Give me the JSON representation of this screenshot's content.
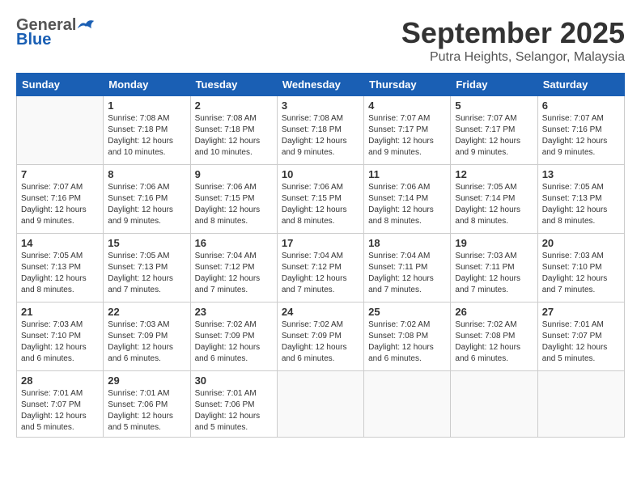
{
  "logo": {
    "general": "General",
    "blue": "Blue"
  },
  "title": "September 2025",
  "location": "Putra Heights, Selangor, Malaysia",
  "weekdays": [
    "Sunday",
    "Monday",
    "Tuesday",
    "Wednesday",
    "Thursday",
    "Friday",
    "Saturday"
  ],
  "weeks": [
    [
      {
        "day": "",
        "sunrise": "",
        "sunset": "",
        "daylight": ""
      },
      {
        "day": "1",
        "sunrise": "Sunrise: 7:08 AM",
        "sunset": "Sunset: 7:18 PM",
        "daylight": "Daylight: 12 hours and 10 minutes."
      },
      {
        "day": "2",
        "sunrise": "Sunrise: 7:08 AM",
        "sunset": "Sunset: 7:18 PM",
        "daylight": "Daylight: 12 hours and 10 minutes."
      },
      {
        "day": "3",
        "sunrise": "Sunrise: 7:08 AM",
        "sunset": "Sunset: 7:18 PM",
        "daylight": "Daylight: 12 hours and 9 minutes."
      },
      {
        "day": "4",
        "sunrise": "Sunrise: 7:07 AM",
        "sunset": "Sunset: 7:17 PM",
        "daylight": "Daylight: 12 hours and 9 minutes."
      },
      {
        "day": "5",
        "sunrise": "Sunrise: 7:07 AM",
        "sunset": "Sunset: 7:17 PM",
        "daylight": "Daylight: 12 hours and 9 minutes."
      },
      {
        "day": "6",
        "sunrise": "Sunrise: 7:07 AM",
        "sunset": "Sunset: 7:16 PM",
        "daylight": "Daylight: 12 hours and 9 minutes."
      }
    ],
    [
      {
        "day": "7",
        "sunrise": "Sunrise: 7:07 AM",
        "sunset": "Sunset: 7:16 PM",
        "daylight": "Daylight: 12 hours and 9 minutes."
      },
      {
        "day": "8",
        "sunrise": "Sunrise: 7:06 AM",
        "sunset": "Sunset: 7:16 PM",
        "daylight": "Daylight: 12 hours and 9 minutes."
      },
      {
        "day": "9",
        "sunrise": "Sunrise: 7:06 AM",
        "sunset": "Sunset: 7:15 PM",
        "daylight": "Daylight: 12 hours and 8 minutes."
      },
      {
        "day": "10",
        "sunrise": "Sunrise: 7:06 AM",
        "sunset": "Sunset: 7:15 PM",
        "daylight": "Daylight: 12 hours and 8 minutes."
      },
      {
        "day": "11",
        "sunrise": "Sunrise: 7:06 AM",
        "sunset": "Sunset: 7:14 PM",
        "daylight": "Daylight: 12 hours and 8 minutes."
      },
      {
        "day": "12",
        "sunrise": "Sunrise: 7:05 AM",
        "sunset": "Sunset: 7:14 PM",
        "daylight": "Daylight: 12 hours and 8 minutes."
      },
      {
        "day": "13",
        "sunrise": "Sunrise: 7:05 AM",
        "sunset": "Sunset: 7:13 PM",
        "daylight": "Daylight: 12 hours and 8 minutes."
      }
    ],
    [
      {
        "day": "14",
        "sunrise": "Sunrise: 7:05 AM",
        "sunset": "Sunset: 7:13 PM",
        "daylight": "Daylight: 12 hours and 8 minutes."
      },
      {
        "day": "15",
        "sunrise": "Sunrise: 7:05 AM",
        "sunset": "Sunset: 7:13 PM",
        "daylight": "Daylight: 12 hours and 7 minutes."
      },
      {
        "day": "16",
        "sunrise": "Sunrise: 7:04 AM",
        "sunset": "Sunset: 7:12 PM",
        "daylight": "Daylight: 12 hours and 7 minutes."
      },
      {
        "day": "17",
        "sunrise": "Sunrise: 7:04 AM",
        "sunset": "Sunset: 7:12 PM",
        "daylight": "Daylight: 12 hours and 7 minutes."
      },
      {
        "day": "18",
        "sunrise": "Sunrise: 7:04 AM",
        "sunset": "Sunset: 7:11 PM",
        "daylight": "Daylight: 12 hours and 7 minutes."
      },
      {
        "day": "19",
        "sunrise": "Sunrise: 7:03 AM",
        "sunset": "Sunset: 7:11 PM",
        "daylight": "Daylight: 12 hours and 7 minutes."
      },
      {
        "day": "20",
        "sunrise": "Sunrise: 7:03 AM",
        "sunset": "Sunset: 7:10 PM",
        "daylight": "Daylight: 12 hours and 7 minutes."
      }
    ],
    [
      {
        "day": "21",
        "sunrise": "Sunrise: 7:03 AM",
        "sunset": "Sunset: 7:10 PM",
        "daylight": "Daylight: 12 hours and 6 minutes."
      },
      {
        "day": "22",
        "sunrise": "Sunrise: 7:03 AM",
        "sunset": "Sunset: 7:09 PM",
        "daylight": "Daylight: 12 hours and 6 minutes."
      },
      {
        "day": "23",
        "sunrise": "Sunrise: 7:02 AM",
        "sunset": "Sunset: 7:09 PM",
        "daylight": "Daylight: 12 hours and 6 minutes."
      },
      {
        "day": "24",
        "sunrise": "Sunrise: 7:02 AM",
        "sunset": "Sunset: 7:09 PM",
        "daylight": "Daylight: 12 hours and 6 minutes."
      },
      {
        "day": "25",
        "sunrise": "Sunrise: 7:02 AM",
        "sunset": "Sunset: 7:08 PM",
        "daylight": "Daylight: 12 hours and 6 minutes."
      },
      {
        "day": "26",
        "sunrise": "Sunrise: 7:02 AM",
        "sunset": "Sunset: 7:08 PM",
        "daylight": "Daylight: 12 hours and 6 minutes."
      },
      {
        "day": "27",
        "sunrise": "Sunrise: 7:01 AM",
        "sunset": "Sunset: 7:07 PM",
        "daylight": "Daylight: 12 hours and 5 minutes."
      }
    ],
    [
      {
        "day": "28",
        "sunrise": "Sunrise: 7:01 AM",
        "sunset": "Sunset: 7:07 PM",
        "daylight": "Daylight: 12 hours and 5 minutes."
      },
      {
        "day": "29",
        "sunrise": "Sunrise: 7:01 AM",
        "sunset": "Sunset: 7:06 PM",
        "daylight": "Daylight: 12 hours and 5 minutes."
      },
      {
        "day": "30",
        "sunrise": "Sunrise: 7:01 AM",
        "sunset": "Sunset: 7:06 PM",
        "daylight": "Daylight: 12 hours and 5 minutes."
      },
      {
        "day": "",
        "sunrise": "",
        "sunset": "",
        "daylight": ""
      },
      {
        "day": "",
        "sunrise": "",
        "sunset": "",
        "daylight": ""
      },
      {
        "day": "",
        "sunrise": "",
        "sunset": "",
        "daylight": ""
      },
      {
        "day": "",
        "sunrise": "",
        "sunset": "",
        "daylight": ""
      }
    ]
  ]
}
